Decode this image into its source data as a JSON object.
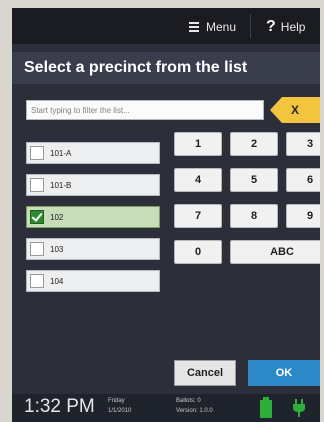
{
  "header": {
    "menu_label": "Menu",
    "help_label": "Help"
  },
  "title": "Select a precinct from the list",
  "filter": {
    "placeholder": "Start typing to filter the list...",
    "clear_label": "X"
  },
  "precincts": [
    {
      "label": "101-A",
      "selected": false
    },
    {
      "label": "101-B",
      "selected": false
    },
    {
      "label": "102",
      "selected": true
    },
    {
      "label": "103",
      "selected": false
    },
    {
      "label": "104",
      "selected": false
    }
  ],
  "keypad": {
    "keys": [
      "1",
      "2",
      "3",
      "4",
      "5",
      "6",
      "7",
      "8",
      "9",
      "0"
    ],
    "abc_label": "ABC"
  },
  "actions": {
    "cancel_label": "Cancel",
    "ok_label": "OK"
  },
  "status": {
    "time": "1:32 PM",
    "day": "Friday",
    "date": "1/1/2010",
    "ballots": "Ballots: 0",
    "version": "Version: 1.0.0"
  },
  "colors": {
    "ok_button": "#2d88c8",
    "clear_button": "#f3c53e",
    "battery": "#2fae3a",
    "selected_row": "#c7dcb8"
  }
}
